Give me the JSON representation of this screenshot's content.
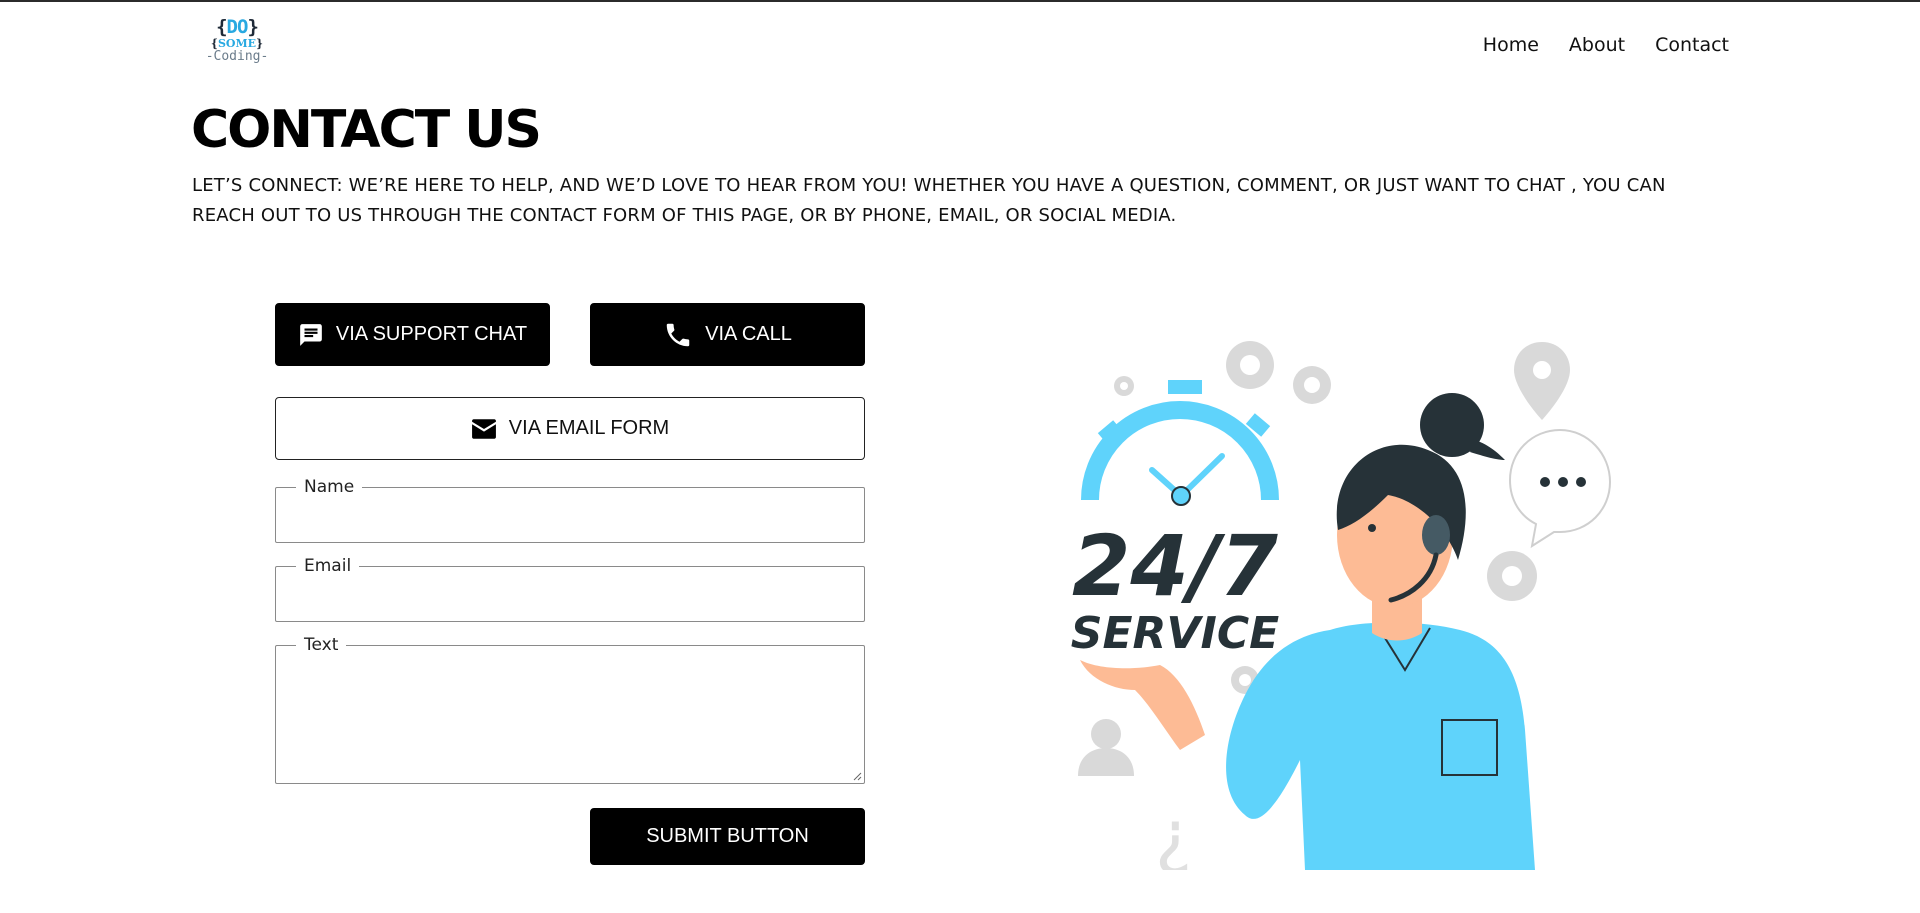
{
  "logo": {
    "line1_open": "{",
    "line1_text": "DO",
    "line1_close": "}",
    "line2_open": "{",
    "line2_text": "SOME",
    "line2_close": "}",
    "line3": "-Coding-"
  },
  "nav": {
    "home": "Home",
    "about": "About",
    "contact": "Contact"
  },
  "page": {
    "title": "CONTACT US",
    "intro": "LET’S CONNECT: WE’RE HERE TO HELP, AND WE’D LOVE TO HEAR FROM YOU! WHETHER YOU HAVE A QUESTION, COMMENT, OR JUST WANT TO CHAT , YOU CAN REACH OUT TO US THROUGH THE CONTACT FORM OF THIS PAGE, OR BY PHONE, EMAIL, OR SOCIAL MEDIA."
  },
  "contact_options": {
    "chat_label": "VIA SUPPORT CHAT",
    "call_label": "VIA CALL",
    "email_label": "VIA EMAIL FORM",
    "chat_icon": "chat-bubble-icon",
    "call_icon": "phone-icon",
    "email_icon": "envelope-icon"
  },
  "form": {
    "name_label": "Name",
    "name_value": "",
    "email_label": "Email",
    "email_value": "",
    "text_label": "Text",
    "text_value": "",
    "submit_label": "SUBMIT BUTTON"
  },
  "illustration": {
    "headline": "24/7",
    "subline": "SERVICE"
  },
  "colors": {
    "accent": "#5fd3fb",
    "dark": "#263238",
    "skin": "#fdbb95",
    "button": "#000000"
  }
}
